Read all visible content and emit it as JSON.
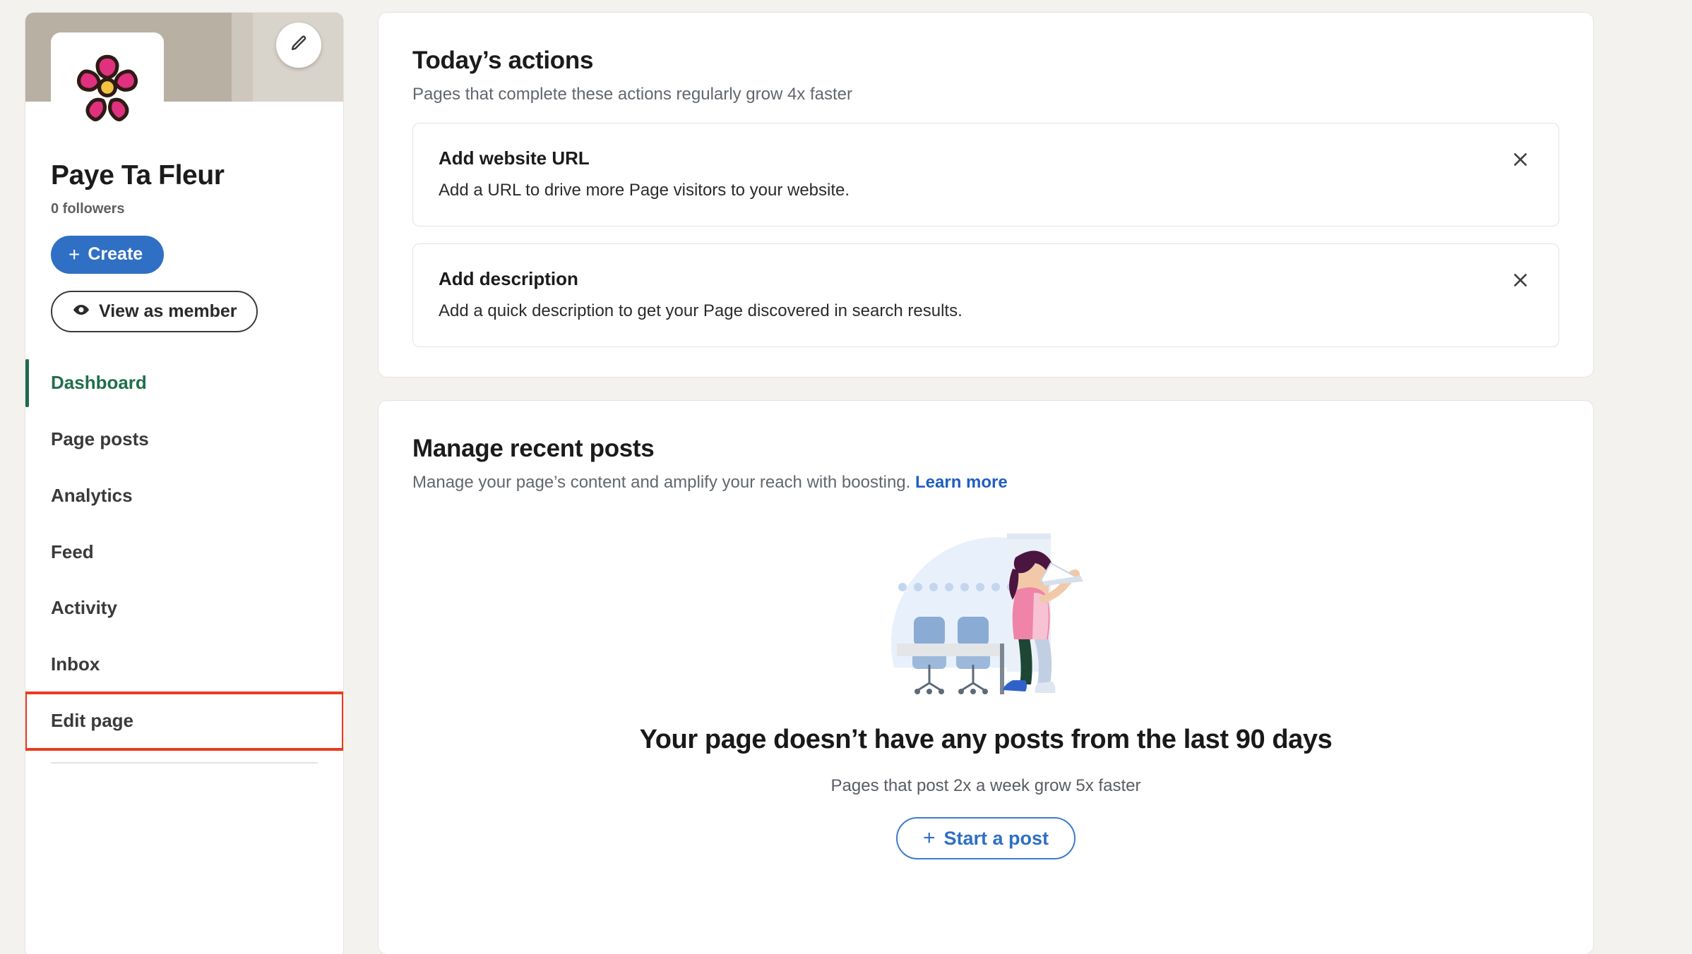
{
  "profile": {
    "name": "Paye Ta Fleur",
    "followers": "0 followers",
    "create_label": "Create",
    "create_plus": "+",
    "view_as_member_label": "View as member",
    "avatar_icon": "flower-icon",
    "cover_edit_icon": "pencil-icon",
    "cover_color": "#b8b0a3",
    "create_button_color": "#2f6fc4"
  },
  "sidebar": {
    "active_color": "#206e4e",
    "highlight_color": "#ea3c1d",
    "items": [
      {
        "label": "Dashboard",
        "active": true,
        "highlight": false
      },
      {
        "label": "Page posts",
        "active": false,
        "highlight": false
      },
      {
        "label": "Analytics",
        "active": false,
        "highlight": false
      },
      {
        "label": "Feed",
        "active": false,
        "highlight": false
      },
      {
        "label": "Activity",
        "active": false,
        "highlight": false
      },
      {
        "label": "Inbox",
        "active": false,
        "highlight": false
      },
      {
        "label": "Edit page",
        "active": false,
        "highlight": true
      }
    ]
  },
  "today_actions": {
    "title": "Today’s actions",
    "subtitle": "Pages that complete these actions regularly grow 4x faster",
    "close_icon": "close-icon",
    "items": [
      {
        "title": "Add website URL",
        "description": "Add a URL to drive more Page visitors to your website."
      },
      {
        "title": "Add description",
        "description": "Add a quick description to get your Page discovered in search results."
      }
    ]
  },
  "manage_posts": {
    "title": "Manage recent posts",
    "subtitle": "Manage your page’s content and amplify your reach with boosting.",
    "learn_more_label": "Learn more",
    "illustration_name": "person-at-standing-desk-illustration",
    "empty_title": "Your page doesn’t have any posts from the last 90 days",
    "empty_subtitle": "Pages that post 2x a week grow 5x faster",
    "start_post_label": "Start a post",
    "start_post_plus": "+",
    "link_color": "#1f5fbf"
  }
}
